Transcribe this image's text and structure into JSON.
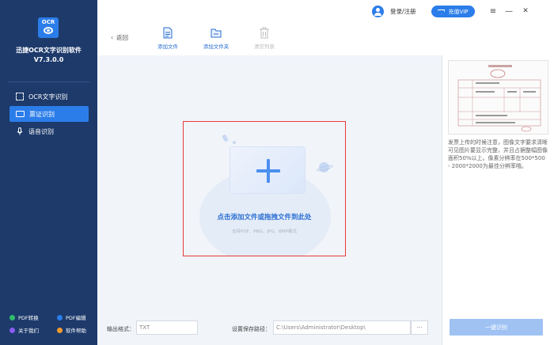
{
  "app": {
    "logo_text": "OCR",
    "name": "迅捷OCR文字识别软件",
    "version": "V7.3.0.0"
  },
  "sidebar": {
    "items": [
      {
        "label": "OCR文字识别",
        "icon": "scan-icon"
      },
      {
        "label": "票证识别",
        "icon": "card-icon",
        "active": true
      },
      {
        "label": "语音识别",
        "icon": "mic-icon"
      }
    ],
    "bottom_links": [
      {
        "label": "PDF转换",
        "color": "#2fbd6b"
      },
      {
        "label": "PDF编辑",
        "color": "#2b7de9"
      },
      {
        "label": "关于我们",
        "color": "#8a5cf0"
      },
      {
        "label": "软件帮助",
        "color": "#f29a2e"
      }
    ]
  },
  "header": {
    "login_label": "登录/注册",
    "vip_label": "充值VIP",
    "menu_icon": "≡",
    "minimize_icon": "—",
    "close_icon": "✕"
  },
  "toolbar": {
    "back_label": "返回",
    "add_file_label": "添加文件",
    "add_folder_label": "添加文件夹",
    "clear_list_label": "清空列表"
  },
  "dropzone": {
    "title": "点击添加文件或拖拽文件到此处",
    "subtitle": "支持PDF、PNG、JPG、BMP格式"
  },
  "footer": {
    "output_format_label": "输出格式：",
    "output_format_value": "TXT",
    "save_path_label": "设置保存路径：",
    "save_path_value": "C:\\Users\\Administrator\\Desktop\\",
    "browse_label": "···"
  },
  "right_panel": {
    "hint": "发票上传的时候注意，图像文字要求清晰可见图片要显示完整，并且占据整幅图像面积50%以上。像素分辨率在500*500 - 2000*2000为最佳分辨率哦。",
    "recognize_label": "一键识别"
  },
  "colors": {
    "sidebar_bg": "#1d3a6b",
    "accent": "#2b7de9",
    "dropzone_border": "#e83a3a",
    "recognize_disabled": "#9fc2f3"
  }
}
